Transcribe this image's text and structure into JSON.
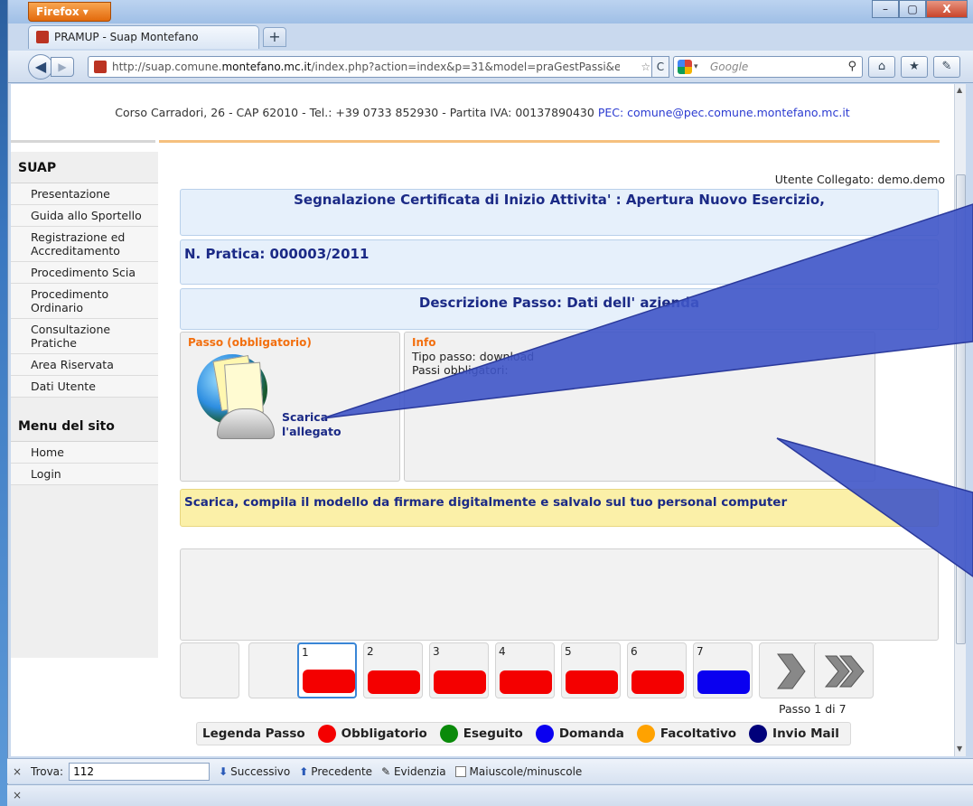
{
  "browser": {
    "app_button": "Firefox ▾",
    "tab_title": "PRAMUP - Suap Montefano",
    "url_prefix": "http://suap.comune.",
    "url_domain": "montefano.mc.it",
    "url_suffix": "/index.php?action=index&p=31&model=praGestPassi&event:",
    "search_placeholder": "Google",
    "window_controls": [
      "–",
      "▢",
      "X"
    ]
  },
  "header": {
    "address": "Corso Carradori, 26 - CAP 62010 - Tel.: +39 0733 852930 - Partita IVA: 00137890430 ",
    "pec": "PEC: comune@pec.comune.montefano.mc.it"
  },
  "sidebar": {
    "suap_title": "SUAP",
    "items": [
      "Presentazione",
      "Guida allo Sportello",
      "Registrazione ed Accreditamento",
      "Procedimento Scia",
      "Procedimento Ordinario",
      "Consultazione Pratiche",
      "Area Riservata",
      "Dati Utente"
    ],
    "menu_title": "Menu del sito",
    "menu_items": [
      "Home",
      "Login"
    ]
  },
  "main": {
    "user": "Utente Collegato: demo.demo",
    "title": "Segnalazione Certificata di Inizio Attivita' : Apertura Nuovo Esercizio,",
    "pratica": "N. Pratica: 000003/2011",
    "descrizione": "Descrizione Passo: Dati dell' azienda",
    "passo_label": "Passo (obbligatorio)",
    "passo_link_line1": "Scarica",
    "passo_link_line2": "l'allegato",
    "info_label": "Info",
    "info_line1": "Tipo passo: download",
    "info_line2": "Passi obbligatori:",
    "instruction": "Scarica, compila il modello da firmare digitalmente e salvalo sul tuo personal computer",
    "steps": [
      {
        "num": "1",
        "status": "red",
        "selected": true
      },
      {
        "num": "2",
        "status": "red"
      },
      {
        "num": "3",
        "status": "red"
      },
      {
        "num": "4",
        "status": "red"
      },
      {
        "num": "5",
        "status": "red"
      },
      {
        "num": "6",
        "status": "red"
      },
      {
        "num": "7",
        "status": "blue"
      }
    ],
    "page_counter": "Passo 1 di 7",
    "legend": {
      "title": "Legenda Passo",
      "items": [
        {
          "label": "Obbligatorio",
          "color": "#f40000"
        },
        {
          "label": "Eseguito",
          "color": "#0a8a0a"
        },
        {
          "label": "Domanda",
          "color": "#0a00f0"
        },
        {
          "label": "Facoltativo",
          "color": "#ffa200"
        },
        {
          "label": "Invio Mail",
          "color": "#00007a"
        }
      ]
    }
  },
  "findbar": {
    "label": "Trova:",
    "value": "112",
    "next": "Successivo",
    "prev": "Precedente",
    "highlight": "Evidenzia",
    "match_case": "Maiuscole/minuscole"
  },
  "statusbar": {
    "close": "×"
  }
}
